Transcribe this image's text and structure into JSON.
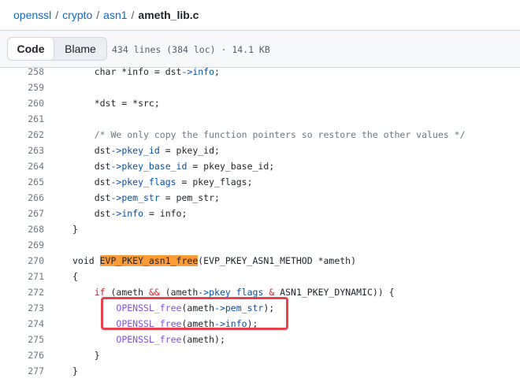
{
  "breadcrumb": {
    "repo": "openssl",
    "sep": "/",
    "dir1": "crypto",
    "dir2": "asn1",
    "file": "ameth_lib.c"
  },
  "toolbar": {
    "code_label": "Code",
    "blame_label": "Blame",
    "file_info": "434 lines (384 loc) · 14.1 KB"
  },
  "code_lines": [
    {
      "num": "258",
      "text": "    char *info = dst->info;"
    },
    {
      "num": "259",
      "text": ""
    },
    {
      "num": "260",
      "text": "    *dst = *src;"
    },
    {
      "num": "261",
      "text": ""
    },
    {
      "num": "262",
      "text": "    /* We only copy the function pointers so restore the other values */"
    },
    {
      "num": "263",
      "text": "    dst->pkey_id = pkey_id;"
    },
    {
      "num": "264",
      "text": "    dst->pkey_base_id = pkey_base_id;"
    },
    {
      "num": "265",
      "text": "    dst->pkey_flags = pkey_flags;"
    },
    {
      "num": "266",
      "text": "    dst->pem_str = pem_str;"
    },
    {
      "num": "267",
      "text": "    dst->info = info;"
    },
    {
      "num": "268",
      "text": "}"
    },
    {
      "num": "269",
      "text": ""
    },
    {
      "num": "270",
      "text": "void EVP_PKEY_asn1_free(EVP_PKEY_ASN1_METHOD *ameth)"
    },
    {
      "num": "271",
      "text": "{"
    },
    {
      "num": "272",
      "text": "    if (ameth && (ameth->pkey_flags & ASN1_PKEY_DYNAMIC)) {"
    },
    {
      "num": "273",
      "text": "        OPENSSL_free(ameth->pem_str);"
    },
    {
      "num": "274",
      "text": "        OPENSSL_free(ameth->info);"
    },
    {
      "num": "275",
      "text": "        OPENSSL_free(ameth);"
    },
    {
      "num": "276",
      "text": "    }"
    },
    {
      "num": "277",
      "text": "}"
    }
  ],
  "highlighted_symbol": "EVP_PKEY_asn1_free",
  "colors": {
    "link": "#0969da",
    "keyword": "#cf222e",
    "function": "#8250df",
    "property": "#0550ae",
    "comment": "#6e7781",
    "symbol_highlight": "#ff9b36",
    "annotation_box": "#e8424e"
  }
}
